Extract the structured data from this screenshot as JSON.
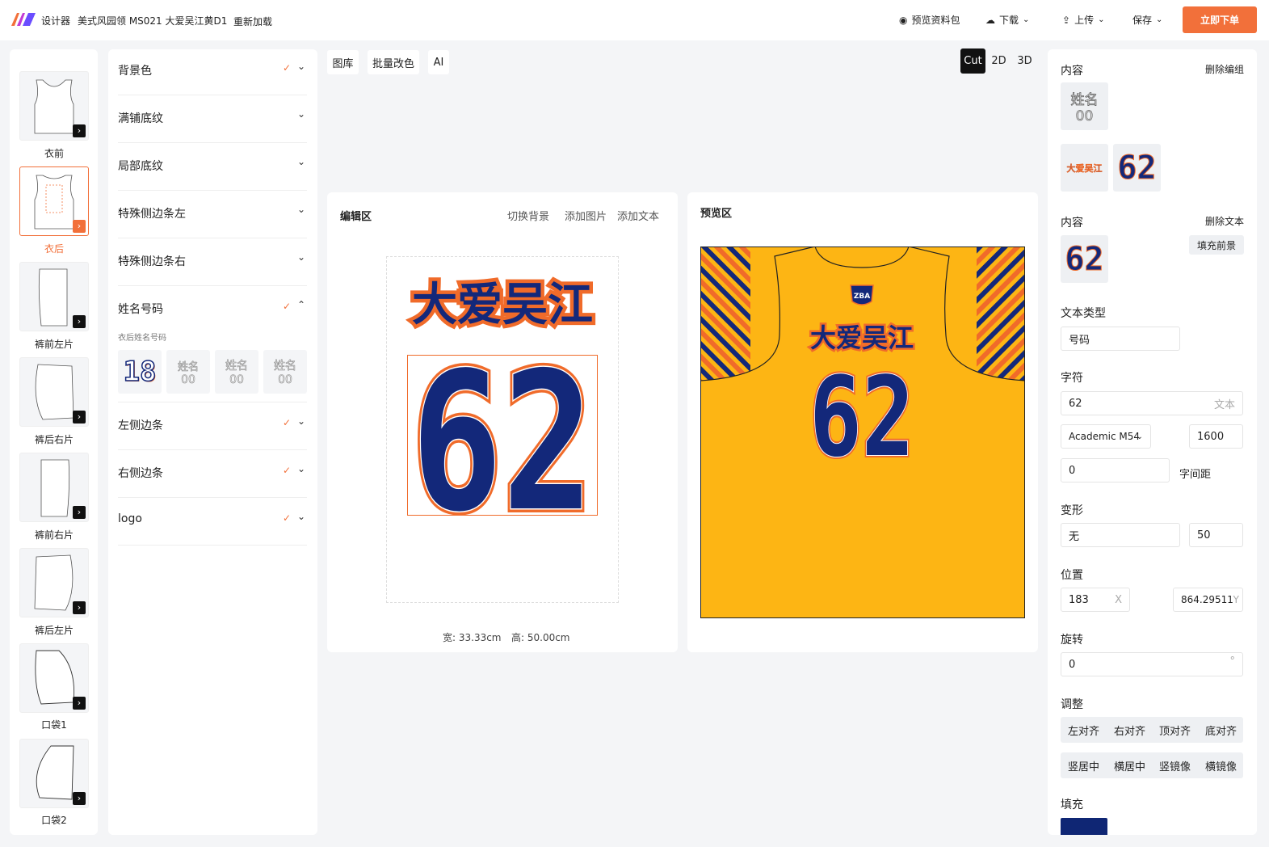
{
  "header": {
    "app_name": "设计器",
    "doc_title": "美式风园领 MS021 大爱吴江黄D1",
    "reload": "重新加载",
    "preview_pack": "预览资料包",
    "download": "下载",
    "upload": "上传",
    "save": "保存",
    "order": "立即下单"
  },
  "pieces": [
    "衣前",
    "衣后",
    "裤前左片",
    "裤后右片",
    "裤前右片",
    "裤后左片",
    "口袋1",
    "口袋2"
  ],
  "layers": {
    "items": [
      "背景色",
      "满铺底纹",
      "局部底纹",
      "特殊侧边条左",
      "特殊侧边条右",
      "姓名号码",
      "左侧边条",
      "右侧边条",
      "logo"
    ],
    "name_number_sub": "衣后姓名号码",
    "font_sample": "18",
    "tile_text_top": "姓名",
    "tile_text_bottom": "00"
  },
  "toolbar": {
    "library": "图库",
    "batch_color": "批量改色",
    "ai": "AI",
    "cut": "Cut",
    "mode_2d": "2D",
    "mode_3d": "3D"
  },
  "editor": {
    "title": "编辑区",
    "switch_bg": "切换背景",
    "add_image": "添加图片",
    "add_text": "添加文本",
    "team_text": "大爱吴江",
    "number": "62",
    "width_label": "宽: 33.33cm",
    "height_label": "高: 50.00cm"
  },
  "preview": {
    "title": "预览区",
    "logo_text": "ZBA"
  },
  "props": {
    "content": "内容",
    "delete_group": "删除编组",
    "delete_text": "删除文本",
    "fill_fg": "填充前景",
    "text_type_label": "文本类型",
    "text_type_value": "号码",
    "char_label": "字符",
    "char_value": "62",
    "char_suffix": "文本",
    "font_value": "Academic M54",
    "font_size": "1600",
    "spacing_value": "0",
    "spacing_label": "字间距",
    "transform_label": "变形",
    "transform_value": "无",
    "transform_amount": "50",
    "position_label": "位置",
    "pos_x": "183",
    "pos_x_suffix": "X",
    "pos_y": "864.29511",
    "pos_y_suffix": "Y",
    "rotate_label": "旋转",
    "rotate_value": "0",
    "rotate_suffix": "°",
    "adjust_label": "调整",
    "adjust_buttons": [
      "左对齐",
      "右对齐",
      "顶对齐",
      "底对齐",
      "竖居中",
      "横居中",
      "竖镜像",
      "横镜像"
    ],
    "fill_label": "填充",
    "fill_color": "#0f2674"
  },
  "colors": {
    "accent": "#f2703a",
    "navy": "#13287a",
    "orange": "#f06b2a",
    "jersey_yellow": "#fdb514"
  }
}
